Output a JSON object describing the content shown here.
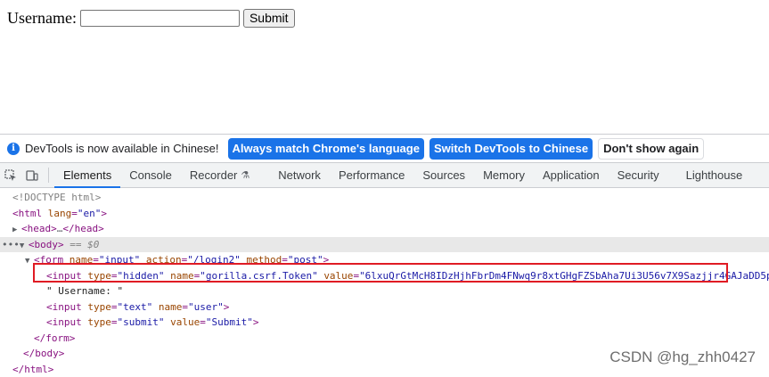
{
  "page": {
    "label": "Username:",
    "input_value": "",
    "submit_label": "Submit"
  },
  "devtools": {
    "infobar": {
      "text": "DevTools is now available in Chinese!",
      "btn_match": "Always match Chrome's language",
      "btn_switch": "Switch DevTools to Chinese",
      "btn_dismiss": "Don't show again"
    },
    "tabs": [
      "Elements",
      "Console",
      "Recorder",
      "Network",
      "Performance",
      "Sources",
      "Memory",
      "Application",
      "Security",
      "Lighthouse"
    ],
    "dom": {
      "doctype": "<!DOCTYPE html>",
      "html_tag": "html",
      "html_attr": "lang",
      "html_val": "\"en\"",
      "head_open": "<head>",
      "head_ellipsis": "…",
      "head_close": "</head>",
      "body_open": "<body>",
      "body_ref": "== $0",
      "form_tag": "form",
      "form_attr1": "name",
      "form_val1": "\"input\"",
      "form_attr2": "action",
      "form_val2": "\"/login2\"",
      "form_attr3": "method",
      "form_val3": "\"post\"",
      "hidden_attr1": "type",
      "hidden_val1": "\"hidden\"",
      "hidden_attr2": "name",
      "hidden_val2": "\"gorilla.csrf.Token\"",
      "hidden_attr3": "value",
      "hidden_val3": "\"6lxuQrGtMcH8IDzHjhFbrDm4FNwq9r8xtGHgFZSbAha7Ui3U56v7X9Sazjjr4GAJaDD5p",
      "text_node": "\" Username: \"",
      "text_input_attr1": "type",
      "text_input_val1": "\"text\"",
      "text_input_attr2": "name",
      "text_input_val2": "\"user\"",
      "submit_attr1": "type",
      "submit_val1": "\"submit\"",
      "submit_attr2": "value",
      "submit_val2": "\"Submit\"",
      "form_close": "</form>",
      "body_close": "</body>",
      "html_close": "</html>"
    }
  },
  "watermark": "CSDN @hg_zhh0427"
}
